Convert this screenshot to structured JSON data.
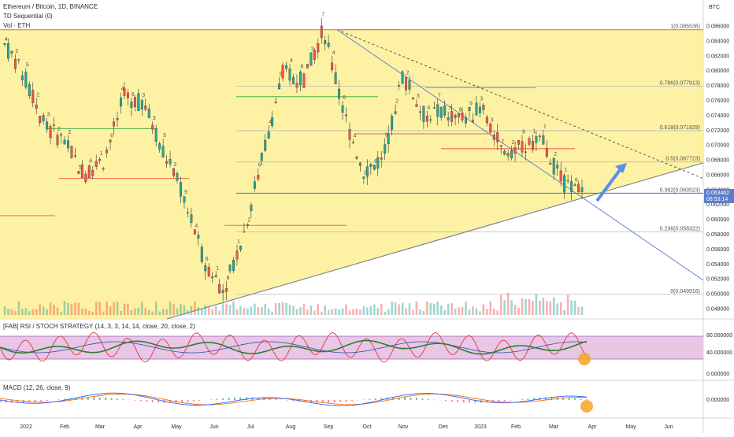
{
  "header": {
    "symbol": "Ethereum / Bitcoin, 1D, BINANCE",
    "indicator1": "TD Sequential (0)",
    "indicator2": "Vol · ETH"
  },
  "price_axis": {
    "unit": "BTC",
    "ticks": [
      "0.086000",
      "0.084000",
      "0.082000",
      "0.080000",
      "0.078000",
      "0.076000",
      "0.074000",
      "0.072000",
      "0.070000",
      "0.068000",
      "0.066000",
      "0.064000",
      "0.062000",
      "0.060000",
      "0.058000",
      "0.056000",
      "0.054000",
      "0.052000",
      "0.050000",
      "0.048000"
    ],
    "current_price": "0.063462",
    "countdown": "06:53:14",
    "current_color": "#5b7ec9"
  },
  "fib_levels": [
    {
      "label": "1(0.085536)",
      "value": 0.085536
    },
    {
      "label": "0.786(0.077913)",
      "value": 0.077913
    },
    {
      "label": "0.618(0.071929)",
      "value": 0.071929
    },
    {
      "label": "0.5(0.067723)",
      "value": 0.067723
    },
    {
      "label": "0.382(0.063523)",
      "value": 0.063523
    },
    {
      "label": "0.236(0.058322)",
      "value": 0.058322
    },
    {
      "label": "0(0.049916)",
      "value": 0.049916
    }
  ],
  "time_axis": [
    "2022",
    "Feb",
    "Mar",
    "Apr",
    "May",
    "Jun",
    "Jul",
    "Aug",
    "Sep",
    "Oct",
    "Nov",
    "Dec",
    "2023",
    "Feb",
    "Mar",
    "Apr",
    "May",
    "Jun"
  ],
  "rsi_pane": {
    "title": "[FAB] RSI / STOCH STRATEGY (14, 3, 3, 14, 14, close, 20, close, 2)",
    "ticks": [
      "80.000000",
      "40.000000",
      "0.000000"
    ]
  },
  "macd_pane": {
    "title": "MACD (12, 26, close, 9)",
    "ticks": [
      "0.000000"
    ]
  },
  "colors": {
    "zone": "#fdf2a3",
    "rsi_band": "#e7c6e6",
    "up": "#26a69a",
    "down": "#ef5350",
    "td": "#2e7d32",
    "arrow": "#5b8ee6",
    "macd_line": "#2962ff",
    "signal_line": "#ff6d00",
    "highlight": "#f5a623"
  },
  "chart_data": {
    "type": "line",
    "title": "Ethereum / Bitcoin, 1D, BINANCE",
    "x": [
      "2022-01",
      "2022-01-15",
      "2022-02",
      "2022-02-15",
      "2022-03",
      "2022-03-15",
      "2022-04",
      "2022-04-15",
      "2022-05",
      "2022-05-15",
      "2022-06",
      "2022-06-15",
      "2022-07",
      "2022-07-15",
      "2022-08",
      "2022-08-15",
      "2022-09",
      "2022-09-15",
      "2022-10",
      "2022-10-15",
      "2022-11",
      "2022-11-15",
      "2022-12",
      "2022-12-15",
      "2023-01",
      "2023-01-15",
      "2023-02",
      "2023-02-15",
      "2023-03",
      "2023-03-15"
    ],
    "series": [
      {
        "values": [
          0.0835,
          0.079,
          0.0725,
          0.0705,
          0.066,
          0.068,
          0.0765,
          0.0755,
          0.069,
          0.063,
          0.0545,
          0.0505,
          0.058,
          0.069,
          0.08,
          0.0785,
          0.0855,
          0.0745,
          0.0665,
          0.068,
          0.0795,
          0.074,
          0.0745,
          0.0735,
          0.075,
          0.069,
          0.07,
          0.0705,
          0.065,
          0.0635
        ]
      }
    ],
    "ylim": [
      0.047,
      0.0875
    ]
  }
}
